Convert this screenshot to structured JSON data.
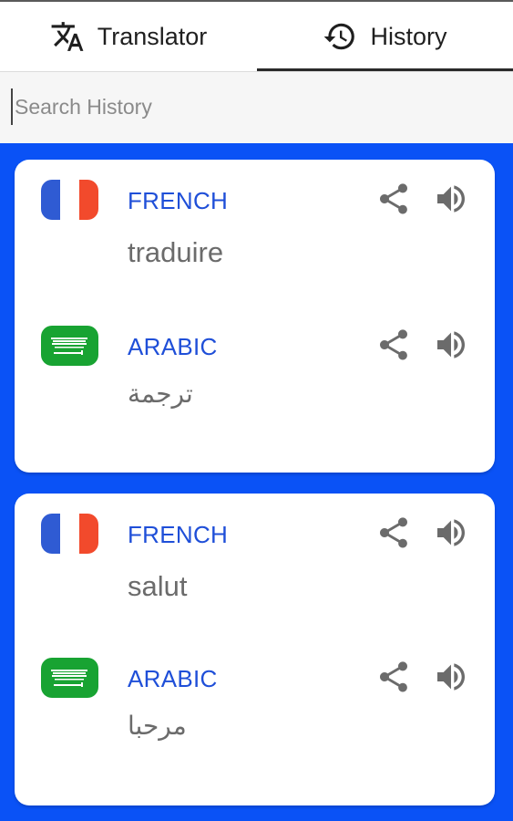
{
  "tabs": {
    "translator": "Translator",
    "history": "History"
  },
  "search": {
    "placeholder": "Search History",
    "value": ""
  },
  "history": [
    {
      "source": {
        "language": "FRENCH",
        "text": "traduire",
        "flag": "france-flag"
      },
      "target": {
        "language": "ARABIC",
        "text": "ترجمة",
        "flag": "saudi-arabia-flag"
      }
    },
    {
      "source": {
        "language": "FRENCH",
        "text": "salut",
        "flag": "france-flag"
      },
      "target": {
        "language": "ARABIC",
        "text": "مرحبا",
        "flag": "saudi-arabia-flag"
      }
    }
  ],
  "colors": {
    "background": "#0a52f6",
    "language_label": "#1f4fd8",
    "icon": "#6b6b6b"
  }
}
